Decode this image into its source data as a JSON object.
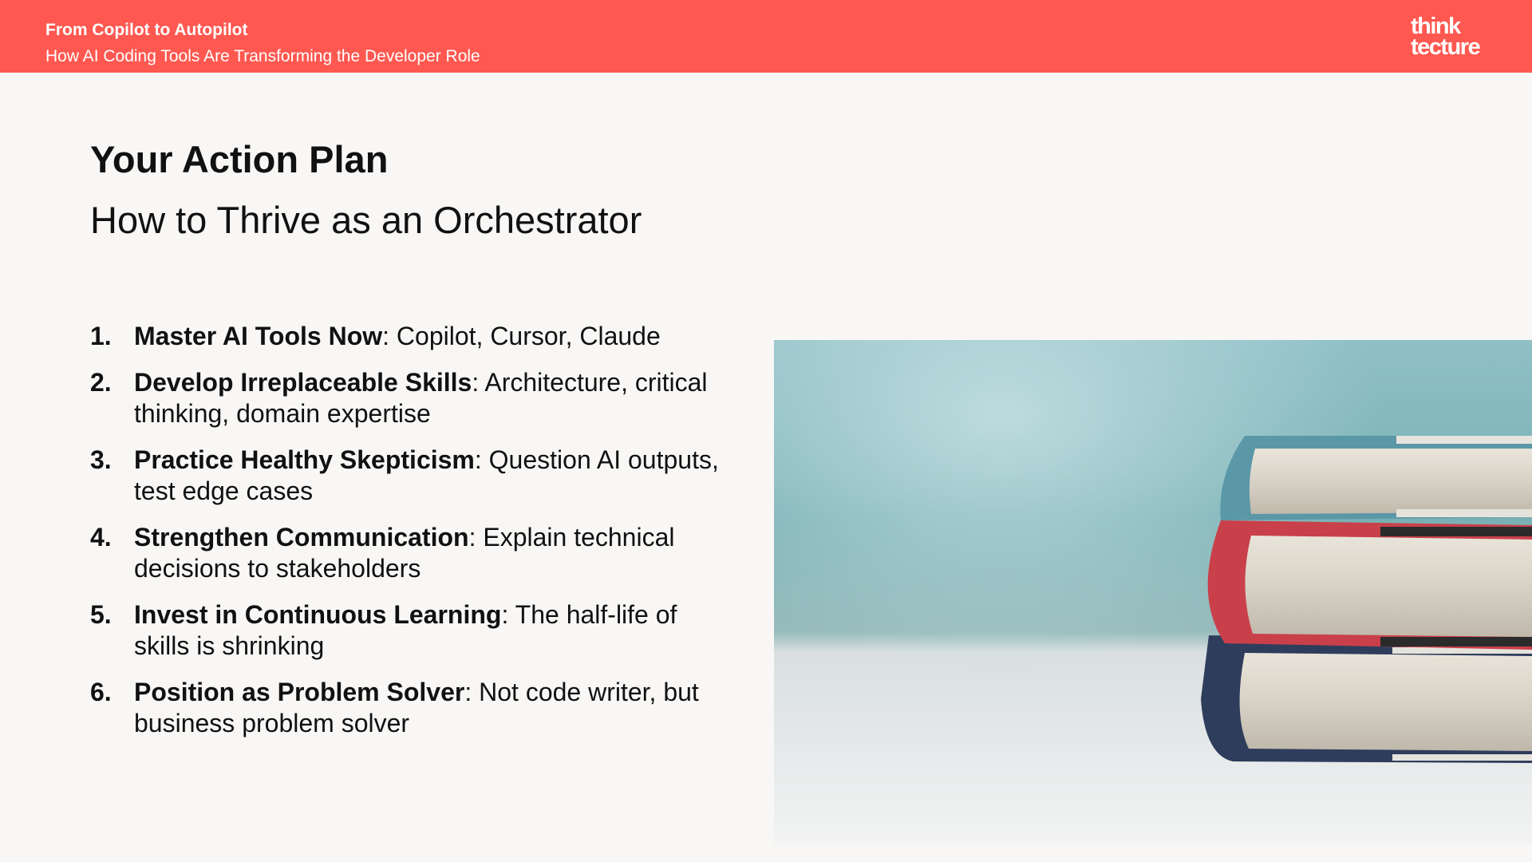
{
  "header": {
    "title": "From Copilot to Autopilot",
    "subtitle": "How AI Coding Tools Are Transforming the Developer Role",
    "logo_line1": "think",
    "logo_line2": "tecture",
    "color": "#ff5850"
  },
  "slide": {
    "title": "Your Action Plan",
    "subtitle": "How to Thrive as an Orchestrator"
  },
  "plan": [
    {
      "num": "1.",
      "term": "Master AI Tools Now",
      "desc": ": Copilot, Cursor, Claude"
    },
    {
      "num": "2.",
      "term": "Develop Irreplaceable Skills",
      "desc": ": Architecture, critical thinking, domain expertise"
    },
    {
      "num": "3.",
      "term": "Practice Healthy Skepticism",
      "desc": ": Question AI outputs, test edge cases"
    },
    {
      "num": "4.",
      "term": "Strengthen Communication",
      "desc": ": Explain technical decisions to stakeholders"
    },
    {
      "num": "5.",
      "term": "Invest in Continuous Learning",
      "desc": ": The half-life of skills is shrinking"
    },
    {
      "num": "6.",
      "term": "Position as Problem Solver",
      "desc": ": Not code writer, but business problem solver"
    }
  ],
  "photo": {
    "subject": "stack-of-books-photo"
  }
}
